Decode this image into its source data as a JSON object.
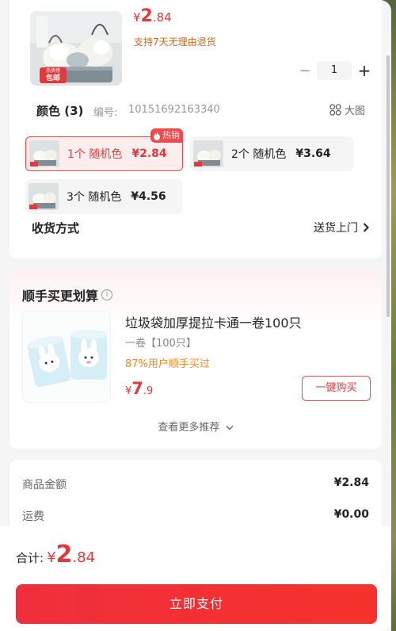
{
  "product": {
    "price": {
      "currency": "¥",
      "integer": "2",
      "decimal": ".84"
    },
    "return_note": "支持7天无理由退货",
    "badge_top": "热卖榜",
    "badge_bottom": "包邮",
    "quantity": "1",
    "minus": "−",
    "plus": "+"
  },
  "color": {
    "title": "颜色 (3)",
    "code_label": "编号:",
    "code_value": "10151692163340",
    "big_pic": "大图",
    "options": [
      {
        "label": "1个 随机色",
        "price": "¥2.84",
        "selected": true,
        "tag": "热销"
      },
      {
        "label": "2个 随机色",
        "price": "¥3.64",
        "selected": false
      },
      {
        "label": "3个 随机色",
        "price": "¥4.56",
        "selected": false
      }
    ]
  },
  "shipping": {
    "label": "收货方式",
    "value": "送货上门"
  },
  "recommend": {
    "title": "顺手买更划算",
    "info": "i",
    "item": {
      "name": "垃圾袋加厚提拉卡通一卷100只",
      "spec": "一卷【100只】",
      "stat": "87%用户顺手买过",
      "price": {
        "currency": "¥",
        "integer": "7",
        "decimal": ".9"
      },
      "buy_label": "一键购买"
    },
    "more_label": "查看更多推荐"
  },
  "summary": {
    "rows": [
      {
        "label": "商品金额",
        "value": "¥2.84"
      },
      {
        "label": "运费",
        "value": "¥0.00"
      }
    ]
  },
  "footer": {
    "total_label": "合计:",
    "total": {
      "currency": "¥",
      "integer": "2",
      "decimal": ".84"
    },
    "pay_label": "立即支付"
  },
  "colors": {
    "accent": "#e4393c",
    "stat": "#f08a24",
    "background": "#f5f5f5"
  },
  "icons": [
    "grid-icon",
    "chevron-right-icon",
    "chevron-down-icon",
    "info-icon",
    "fire-icon"
  ]
}
